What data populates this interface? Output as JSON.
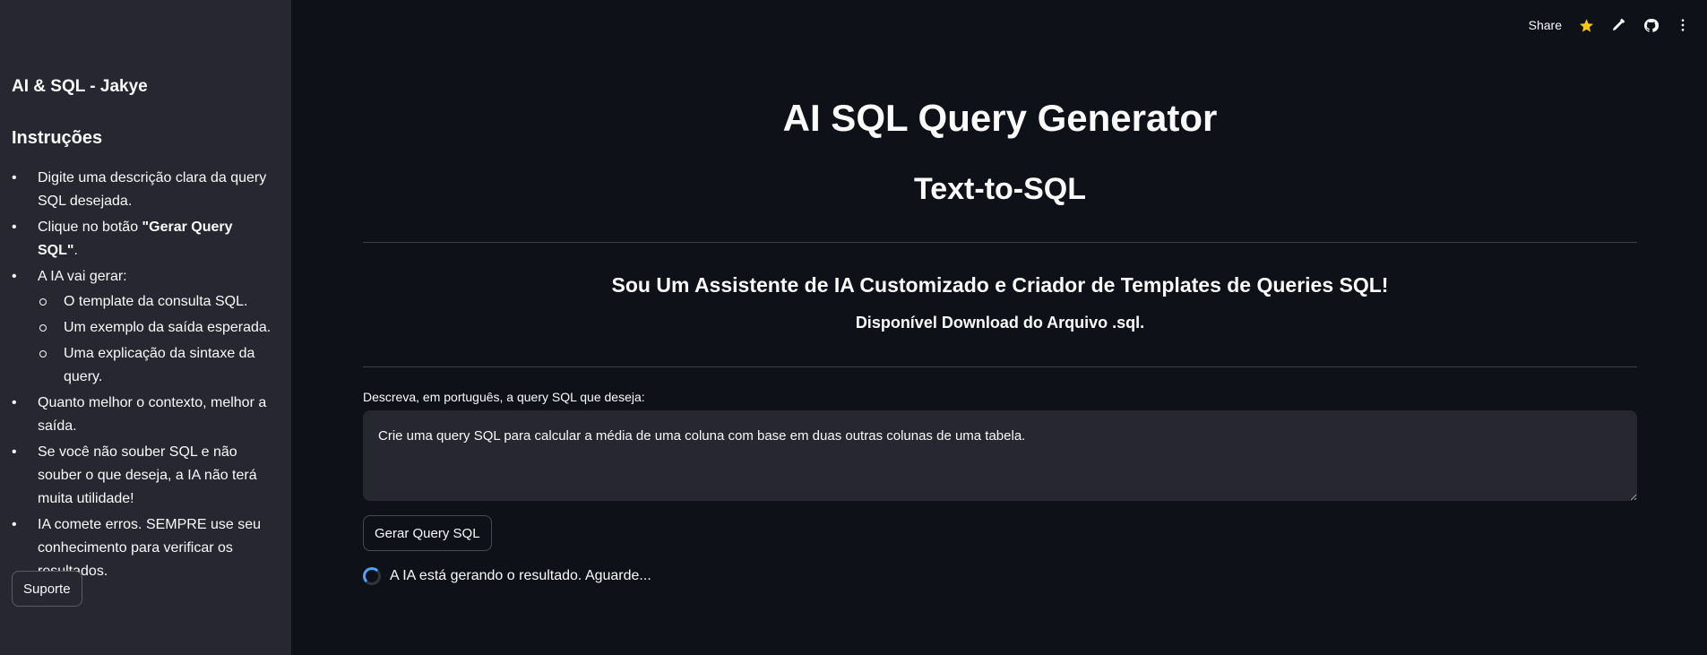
{
  "sidebar": {
    "app_title": "AI & SQL - Jakye",
    "instructions_heading": "Instruções",
    "items": [
      {
        "text": "Digite uma descrição clara da query SQL desejada."
      },
      {
        "prefix": "Clique no botão ",
        "bold": "\"Gerar Query SQL\"",
        "suffix": "."
      },
      {
        "text": "A IA vai gerar:",
        "subitems": [
          "O template da consulta SQL.",
          "Um exemplo da saída esperada.",
          "Uma explicação da sintaxe da query."
        ]
      },
      {
        "text": "Quanto melhor o contexto, melhor a saída."
      },
      {
        "text": "Se você não souber SQL e não souber o que deseja, a IA não terá muita utilidade!"
      },
      {
        "text": "IA comete erros. SEMPRE use seu conhecimento para verificar os resultados."
      }
    ],
    "support_label": "Suporte"
  },
  "toolbar": {
    "share_label": "Share",
    "icons": [
      "star-icon",
      "pencil-icon",
      "github-icon",
      "more-vertical-icon"
    ],
    "star_color": "#f5c518"
  },
  "main": {
    "title": "AI SQL Query Generator",
    "subtitle": "Text-to-SQL",
    "tagline": "Sou Um Assistente de IA Customizado e Criador de Templates de Queries SQL!",
    "download_note": "Disponível Download do Arquivo .sql.",
    "input_label": "Descreva, em português, a query SQL que deseja:",
    "query_value": "Crie uma query SQL para calcular a média de uma coluna com base em duas outras colunas de uma tabela.",
    "generate_label": "Gerar Query SQL",
    "status_text": "A IA está gerando o resultado. Aguarde..."
  },
  "colors": {
    "background": "#0e1117",
    "sidebar": "#262730",
    "accent": "#4da3ff"
  }
}
